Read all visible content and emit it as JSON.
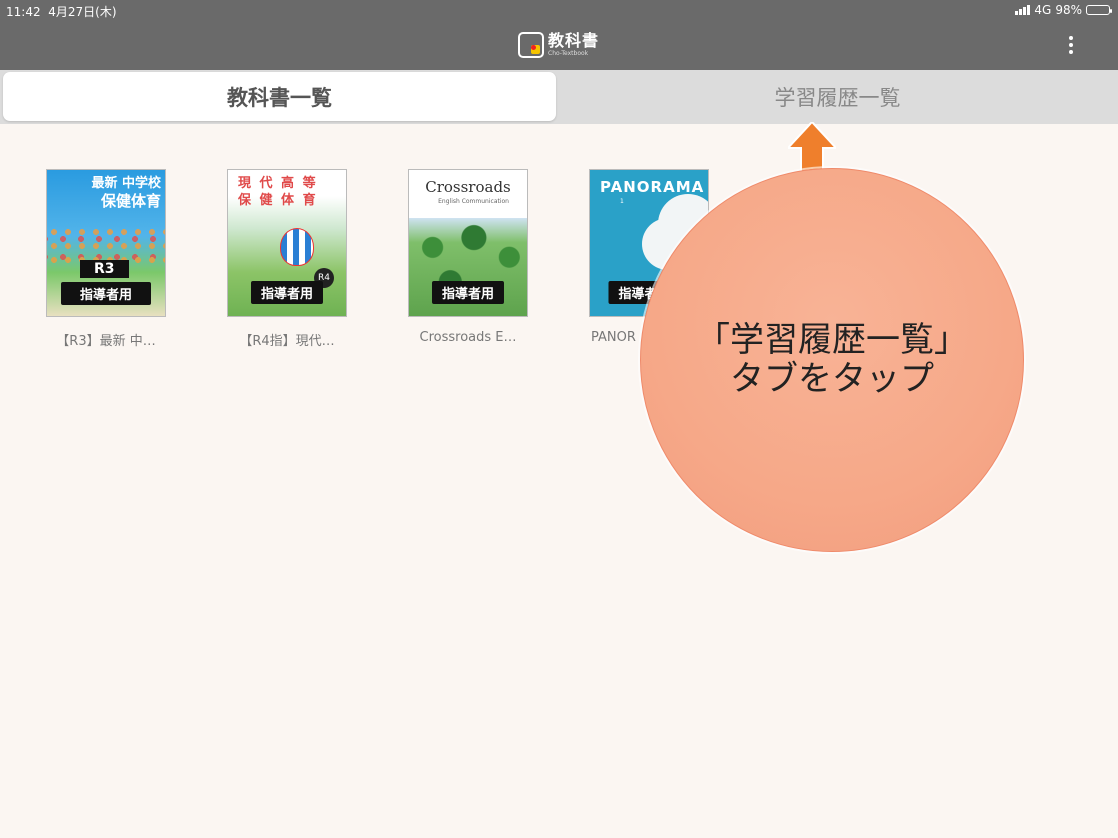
{
  "status_bar": {
    "time": "11:42",
    "date": "4月27日(木)",
    "network": "4G",
    "battery": "98%",
    "battery_level": 0.98
  },
  "app": {
    "logo_text": "教科書",
    "logo_subtext": "Cho-Textbook",
    "menu_icon": "more-vertical-icon"
  },
  "tabs": [
    {
      "label": "教科書一覧",
      "active": true
    },
    {
      "label": "学習履歴一覧",
      "active": false
    }
  ],
  "books": [
    {
      "title": "【R3】最新 中…",
      "cover_title_line1": "最新 中学校",
      "cover_title_line2": "保健体育",
      "edition": "R3",
      "badge": "指導者用"
    },
    {
      "title": "【R4指】現代…",
      "cover_title_line1": "現 代 高 等",
      "cover_title_line2": "保 健 体 育",
      "edition": "R4",
      "badge": "指導者用"
    },
    {
      "title": "Crossroads E…",
      "cover_title_line1": "Crossroads",
      "cover_title_line2": "English Communication",
      "edition": "",
      "badge": "指導者用"
    },
    {
      "title": "PANOR",
      "cover_title_line1": "PANORAMA",
      "cover_title_line2": "1",
      "edition": "",
      "badge": "指導者"
    }
  ],
  "annotation": {
    "line1": "「学習履歴一覧」",
    "line2": "タブをタップ",
    "color": "#f6a888",
    "arrow_color": "#ef7f2c"
  }
}
